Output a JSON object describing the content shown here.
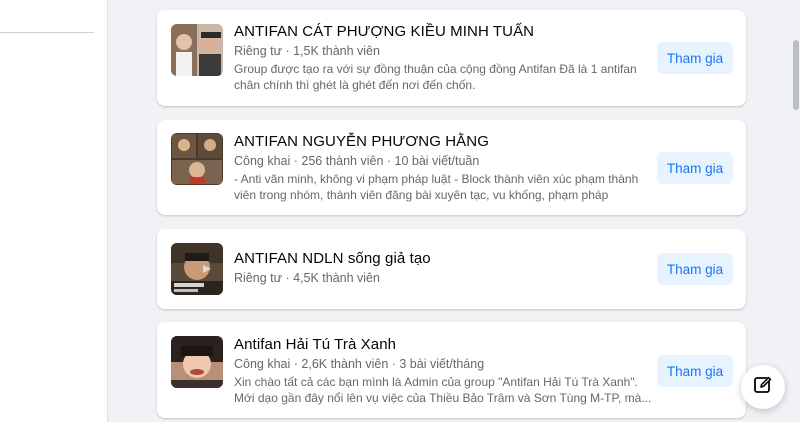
{
  "groups": [
    {
      "title": "ANTIFAN CÁT PHƯỢNG KIỀU MINH TUẤN",
      "meta": "Riêng tư · 1,5K thành viên",
      "description": "Group được tạo ra với sự đồng thuận của cộng đồng Antifan Đã là 1 antifan chân chính thì ghét là ghét đến nơi đến chốn.",
      "button": "Tham gia"
    },
    {
      "title": "ANTIFAN NGUYỄN PHƯƠNG HẰNG",
      "meta": "Công khai · 256 thành viên · 10 bài viết/tuần",
      "description": "- Anti văn minh, không vi phạm pháp luật - Block thành viên xúc phạm thành viên trong nhóm, thành viên đăng bài xuyên tạc, vu khống, phạm pháp",
      "button": "Tham gia"
    },
    {
      "title": "ANTIFAN NDLN sống giả tạo",
      "meta": "Riêng tư · 4,5K thành viên",
      "description": "",
      "button": "Tham gia"
    },
    {
      "title": "Antifan Hải Tú Trà Xanh",
      "meta": "Công khai · 2,6K thành viên · 3 bài viết/tháng",
      "description": "Xin chào tất cả các bạn mình là Admin của group \"Antifan Hải Tú Trà Xanh\". Mới dạo gần đây nổi lên vụ việc của Thiều Bảo Trâm và Sơn Tùng M-TP, mà...",
      "button": "Tham gia"
    }
  ],
  "compose_icon": "compose-edit-icon",
  "colors": {
    "accent": "#1877f2",
    "button_bg": "#e7f3ff",
    "page_bg": "#f0f2f5",
    "secondary_text": "#65676b"
  }
}
